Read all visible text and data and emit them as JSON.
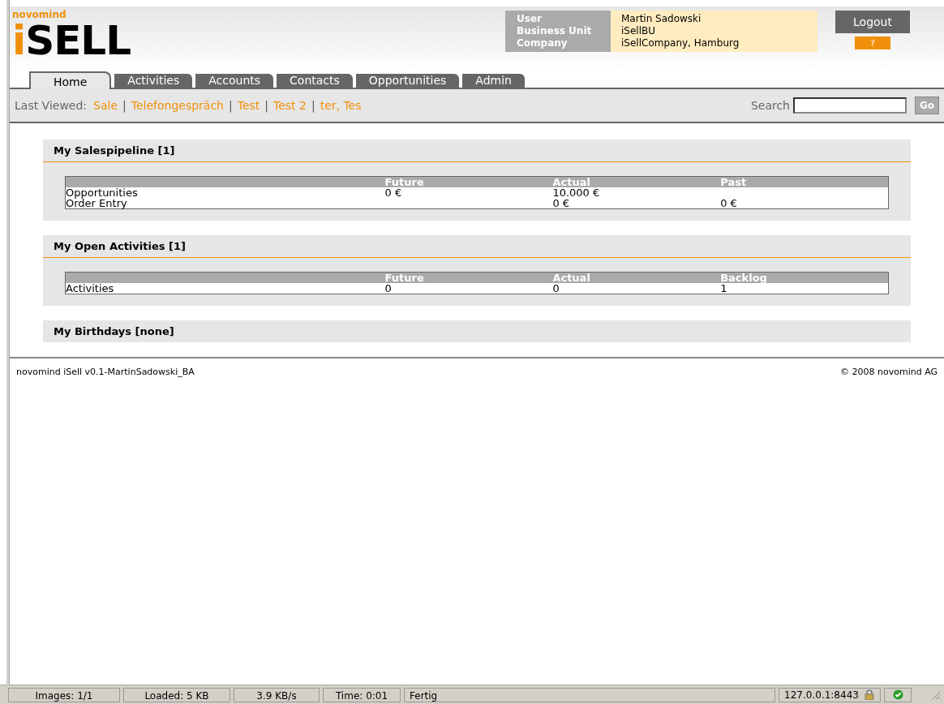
{
  "brand": {
    "company": "novomind",
    "product": "iSELL"
  },
  "user_info": {
    "labels": [
      "User",
      "Business Unit",
      "Company"
    ],
    "values": [
      "Martin Sadowski",
      "iSellBU",
      "iSellCompany, Hamburg"
    ]
  },
  "logout_button": "Logout",
  "help_button": "?",
  "tabs": [
    {
      "label": "Home",
      "selected": true
    },
    {
      "label": "Activities",
      "selected": false
    },
    {
      "label": "Accounts",
      "selected": false
    },
    {
      "label": "Contacts",
      "selected": false
    },
    {
      "label": "Opportunities",
      "selected": false
    },
    {
      "label": "Admin",
      "selected": false
    }
  ],
  "last_viewed": {
    "label": "Last Viewed:",
    "separator": "|",
    "links": [
      "Sale",
      "Telefongespräch",
      "Test",
      "Test 2",
      "ter, Tes"
    ]
  },
  "search": {
    "label": "Search",
    "button": "Go"
  },
  "sections": [
    {
      "title": "My Salespipeline [1]",
      "table": {
        "columns": [
          "Future",
          "Actual",
          "Past"
        ],
        "rows": [
          {
            "label": "Opportunities",
            "cells": [
              "0 €",
              "10.000 €",
              null
            ]
          },
          {
            "label": "Order Entry",
            "cells": [
              null,
              "0 €",
              "0 €"
            ]
          }
        ]
      }
    },
    {
      "title": "My Open Activities [1]",
      "table": {
        "columns": [
          "Future",
          "Actual",
          "Backlog"
        ],
        "rows": [
          {
            "label": "Activities",
            "cells": [
              "0",
              "0",
              "1"
            ]
          }
        ]
      }
    },
    {
      "title": "My Birthdays [none]"
    }
  ],
  "footer": {
    "left": "novomind iSell v0.1-MartinSadowski_BA",
    "right": "© 2008 novomind AG"
  },
  "status_bar": [
    {
      "kind": "text",
      "text": "Images: 1/1"
    },
    {
      "kind": "text",
      "text": "Loaded: 5 KB"
    },
    {
      "kind": "text",
      "text": "3.9 KB/s"
    },
    {
      "kind": "text",
      "text": "Time: 0:01"
    },
    {
      "kind": "message",
      "text": "Fertig"
    },
    {
      "kind": "secure",
      "text": "127.0.0.1:8443"
    },
    {
      "kind": "ok"
    }
  ]
}
